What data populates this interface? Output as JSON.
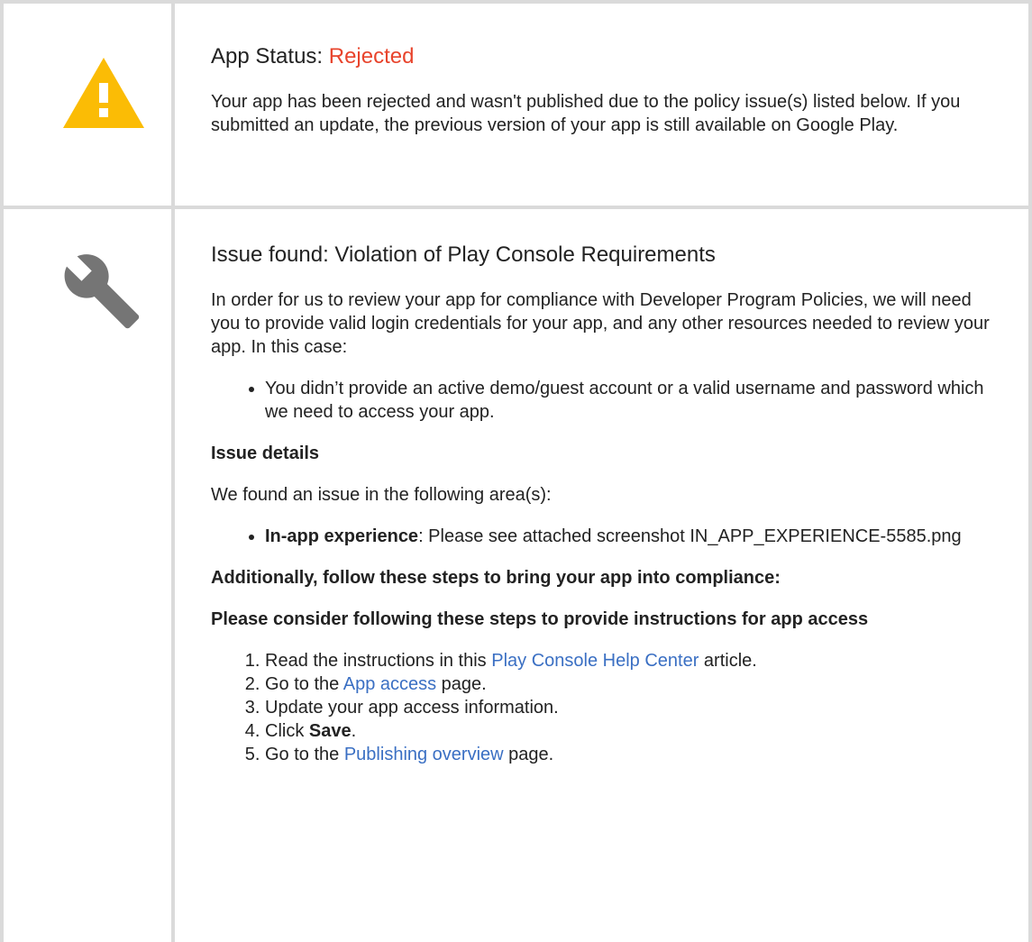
{
  "status": {
    "label": "App Status: ",
    "value": "Rejected",
    "description": "Your app has been rejected and wasn't published due to the policy issue(s) listed below. If you submitted an update, the previous version of your app is still available on Google Play.",
    "icon": "warning-icon",
    "value_color": "#e8442c"
  },
  "issue": {
    "icon": "wrench-icon",
    "title": "Issue found: Violation of Play Console Requirements",
    "intro": "In order for us to review your app for compliance with Developer Program Policies, we will need you to provide valid login credentials for your app, and any other resources needed to review your app. In this case:",
    "bullets": [
      "You didn’t provide an active demo/guest account or a valid username and password which we need to access your app."
    ],
    "details_heading": "Issue details",
    "details_intro": "We found an issue in the following area(s):",
    "details_items": [
      {
        "label": "In-app experience",
        "text": ": Please see attached screenshot IN_APP_EXPERIENCE-5585.png"
      }
    ],
    "additional_heading": "Additionally, follow these steps to bring your app into compliance:",
    "steps_heading": "Please consider following these steps to provide instructions for app access",
    "steps": {
      "s1_before": "Read the instructions in this ",
      "s1_link": "Play Console Help Center",
      "s1_after": " article.",
      "s2_before": "Go to the ",
      "s2_link": "App access",
      "s2_after": " page.",
      "s3": "Update your app access information.",
      "s4_before": "Click ",
      "s4_bold": "Save",
      "s4_after": ".",
      "s5_before": "Go to the ",
      "s5_link": "Publishing overview",
      "s5_after": " page."
    }
  },
  "colors": {
    "border": "#dadada",
    "link": "#3a6fc3",
    "warning": "#fbbc05",
    "wrench": "#757575"
  }
}
